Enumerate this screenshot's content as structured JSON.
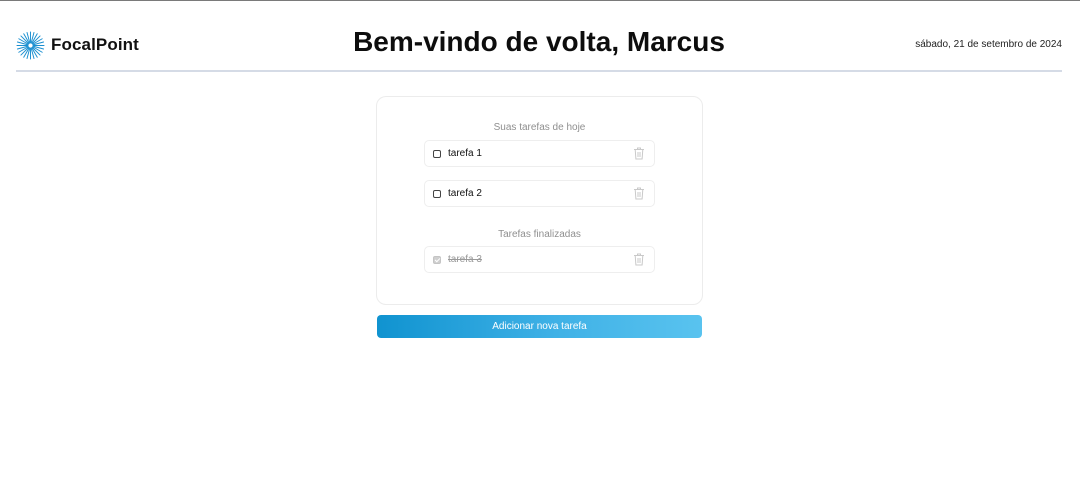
{
  "header": {
    "brand_name": "FocalPoint",
    "brand_logo_icon": "starburst-icon",
    "title": "Bem-vindo de volta, Marcus",
    "date": "sábado, 21 de setembro de 2024"
  },
  "today": {
    "heading": "Suas tarefas de hoje",
    "tasks": [
      {
        "label": "tarefa 1",
        "checked": false,
        "delete_icon": "trash-icon"
      },
      {
        "label": "tarefa 2",
        "checked": false,
        "delete_icon": "trash-icon"
      }
    ]
  },
  "finished": {
    "heading": "Tarefas finalizadas",
    "tasks": [
      {
        "label": "tarefa 3",
        "checked": true,
        "delete_icon": "trash-icon"
      }
    ]
  },
  "actions": {
    "add_task_label": "Adicionar nova tarefa"
  },
  "colors": {
    "accent_start": "#1093d0",
    "accent_end": "#59c3ef",
    "header_divider": "#d5dbe6"
  }
}
